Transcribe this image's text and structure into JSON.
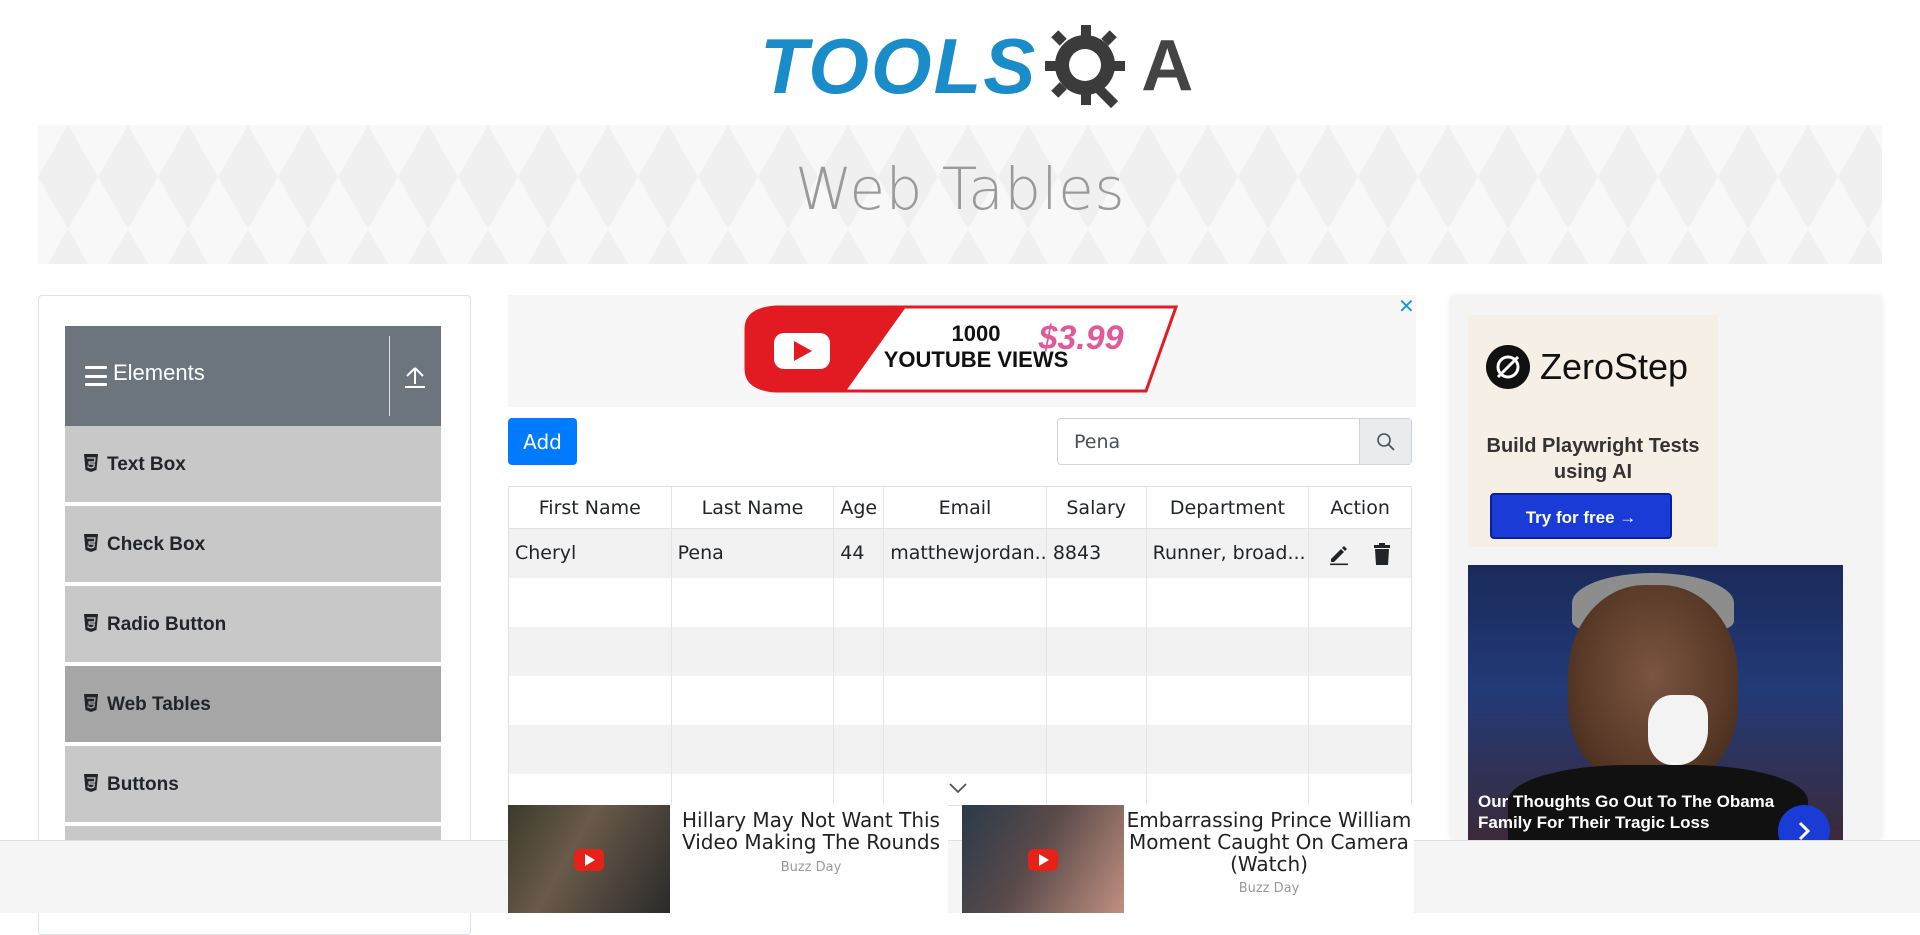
{
  "header": {
    "logo_text": "TOOLS",
    "logo_suffix": "A",
    "page_title": "Web Tables"
  },
  "sidebar": {
    "group_label": "Elements",
    "items": [
      {
        "label": "Text Box"
      },
      {
        "label": "Check Box"
      },
      {
        "label": "Radio Button"
      },
      {
        "label": "Web Tables",
        "active": true
      },
      {
        "label": "Buttons"
      }
    ]
  },
  "top_ad": {
    "line1": "1000",
    "line2": "YOUTUBE VIEWS",
    "price": "$3.99",
    "close": "✕"
  },
  "controls": {
    "add_label": "Add",
    "search_value": "Pena"
  },
  "table": {
    "headers": [
      "First Name",
      "Last Name",
      "Age",
      "Email",
      "Salary",
      "Department",
      "Action"
    ],
    "rows": [
      [
        "Cheryl",
        "Pena",
        "44",
        "matthewjordan...",
        "8843",
        "Runner, broad..."
      ]
    ]
  },
  "right_ad": {
    "brand": "ZeroStep",
    "description": "Build Playwright Tests using AI",
    "cta": "Try for free →",
    "caption": "Our Thoughts Go Out To The Obama Family For Their Tragic Loss"
  },
  "bottom_ads": [
    {
      "headline": "Hillary May Not Want This Video Making The Rounds",
      "source": "Buzz Day"
    },
    {
      "headline": "Embarrassing Prince William Moment Caught On Camera (Watch)",
      "source": "Buzz Day"
    }
  ],
  "colors": {
    "primary": "#007bff",
    "sidebar_header": "#6c757d",
    "menu_item": "#c8c8c8",
    "menu_item_active": "#a6a6a6",
    "logo_blue": "#1a8cc9"
  }
}
